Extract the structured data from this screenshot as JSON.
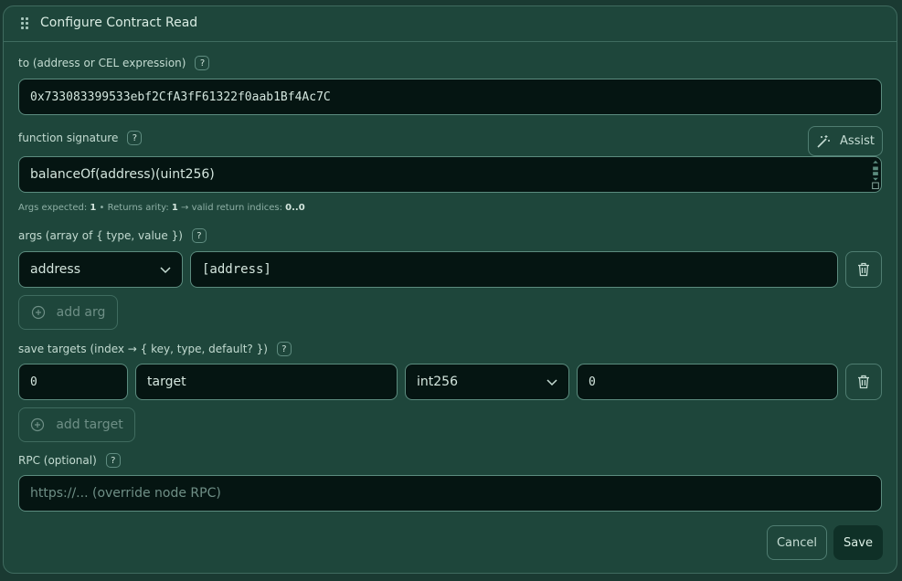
{
  "dialog": {
    "title": "Configure Contract Read"
  },
  "to_field": {
    "label": "to (address or CEL expression)",
    "help": "?",
    "value": "0x733083399533ebf2CfA3fF61322f0aab1Bf4Ac7C"
  },
  "function_field": {
    "label": "function signature",
    "help": "?",
    "value": "balanceOf(address)(uint256)",
    "assist_label": "Assist"
  },
  "hint": {
    "args_expected_label": "Args expected:",
    "args_expected": "1",
    "returns_label": "• Returns arity:",
    "returns": "1",
    "valid_label": "→ valid return indices:",
    "valid": "0..0"
  },
  "args": {
    "label": "args (array of { type, value })",
    "help": "?",
    "rows": [
      {
        "type": "address",
        "value": "[address]"
      }
    ],
    "add_label": "add arg"
  },
  "save_targets": {
    "label": "save targets (index → { key, type, default? })",
    "help": "?",
    "rows": [
      {
        "index": "0",
        "key": "target",
        "type": "int256",
        "default": "0"
      }
    ],
    "add_label": "add target"
  },
  "rpc": {
    "label": "RPC (optional)",
    "help": "?",
    "placeholder": "https://... (override node RPC)"
  },
  "footer": {
    "cancel_label": "Cancel",
    "save_label": "Save"
  }
}
